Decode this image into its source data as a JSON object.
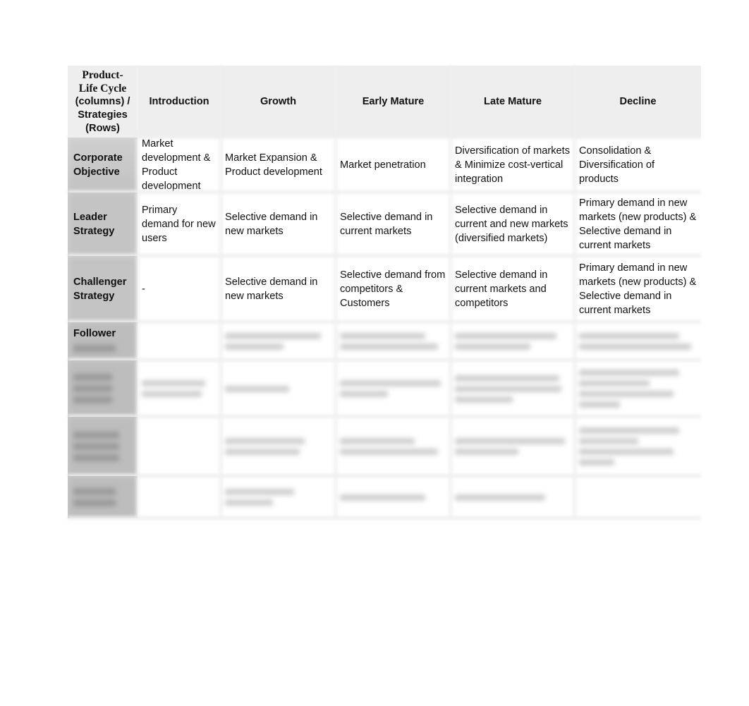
{
  "document": {
    "table": {
      "corner_header": {
        "line1": "Product-",
        "line2": "Life Cycle",
        "line3": "(columns) /",
        "line4": "Strategies",
        "line5": "(Rows)"
      },
      "columns": [
        "Introduction",
        "Growth",
        "Early Mature",
        "Late Mature",
        "Decline"
      ],
      "rows": [
        {
          "label": "Corporate Objective",
          "cells": [
            "Market development & Product development",
            "Market Expansion & Product development",
            "Market penetration",
            "Diversification of markets & Minimize cost-vertical integration",
            "Consolidation & Diversification of products"
          ]
        },
        {
          "label": "Leader Strategy",
          "cells": [
            "Primary demand for new users",
            "Selective demand in new markets",
            "Selective demand in current markets",
            "Selective demand in current and new markets (diversified markets)",
            "Primary demand in new markets (new products) & Selective demand in current markets"
          ]
        },
        {
          "label": "Challenger Strategy",
          "cells": [
            "-",
            "Selective demand in new markets",
            "Selective demand from competitors & Customers",
            "Selective demand in current markets and competitors",
            "Primary demand in new markets (new products) & Selective demand in current markets"
          ]
        },
        {
          "label": "Follower",
          "blurred": true
        },
        {
          "blurred": true
        },
        {
          "blurred": true
        },
        {
          "blurred": true
        }
      ]
    }
  }
}
